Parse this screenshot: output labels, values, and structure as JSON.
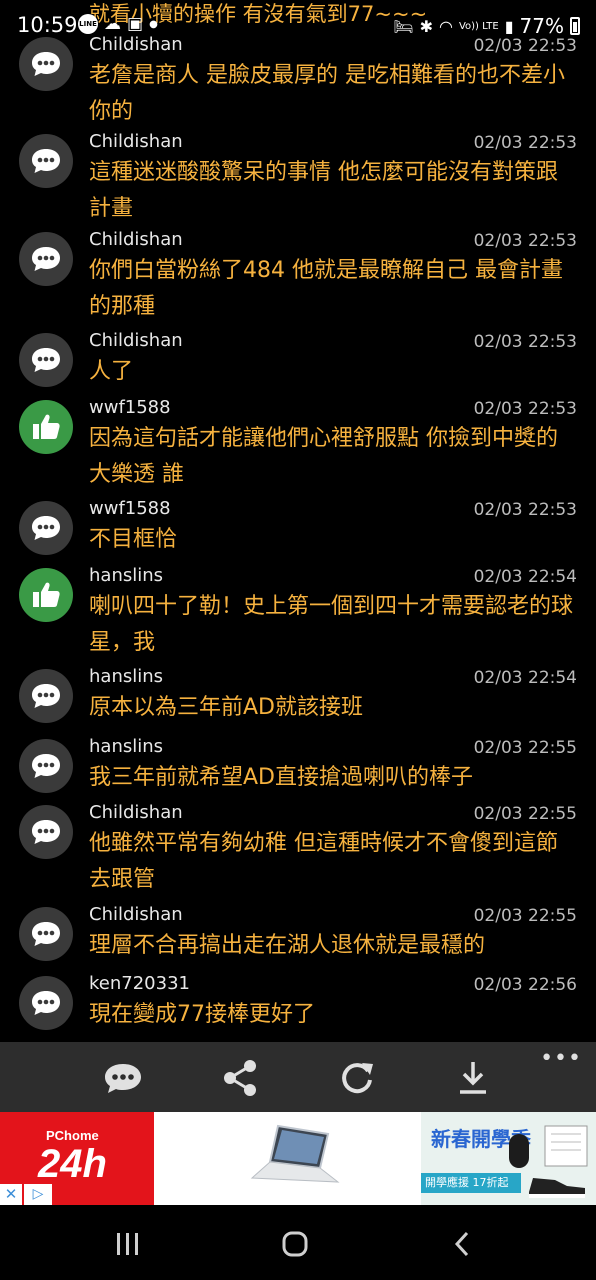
{
  "status_bar": {
    "time": "10:59",
    "line_badge": "LINE",
    "signal_label": "Vo)) LTE",
    "battery": "77%"
  },
  "partial_top_text": "就看小犢的操作 有沒有氣到77~~~",
  "comments": [
    {
      "type": "chat",
      "author": "Childishan",
      "time": "02/03 22:53",
      "text": "老詹是商人 是臉皮最厚的 是吃相難看的也不差小你的"
    },
    {
      "type": "chat",
      "author": "Childishan",
      "time": "02/03 22:53",
      "text": "這種迷迷酸酸驚呆的事情 他怎麼可能沒有對策跟計畫"
    },
    {
      "type": "chat",
      "author": "Childishan",
      "time": "02/03 22:53",
      "text": "你們白當粉絲了484 他就是最瞭解自己 最會計畫的那種"
    },
    {
      "type": "chat",
      "author": "Childishan",
      "time": "02/03 22:53",
      "text": "人了"
    },
    {
      "type": "like",
      "author": "wwf1588",
      "time": "02/03 22:53",
      "text": "因為這句話才能讓他們心裡舒服點 你撿到中獎的大樂透 誰"
    },
    {
      "type": "chat",
      "author": "wwf1588",
      "time": "02/03 22:53",
      "text": "不目框恰"
    },
    {
      "type": "like",
      "author": "hanslins",
      "time": "02/03 22:54",
      "text": "喇叭四十了勒！史上第一個到四十才需要認老的球星，我"
    },
    {
      "type": "chat",
      "author": "hanslins",
      "time": "02/03 22:54",
      "text": "原本以為三年前AD就該接班"
    },
    {
      "type": "chat",
      "author": "hanslins",
      "time": "02/03 22:55",
      "text": "我三年前就希望AD直接搶過喇叭的棒子"
    },
    {
      "type": "chat",
      "author": "Childishan",
      "time": "02/03 22:55",
      "text": "他雖然平常有夠幼稚 但這種時候才不會傻到這節去跟管"
    },
    {
      "type": "chat",
      "author": "Childishan",
      "time": "02/03 22:55",
      "text": "理層不合再搞出走在湖人退休就是最穩的"
    },
    {
      "type": "chat",
      "author": "ken720331",
      "time": "02/03 22:56",
      "text": "現在變成77接棒更好了"
    }
  ],
  "toolbar": {
    "buttons": [
      "comment-icon",
      "share-icon",
      "refresh-icon",
      "download-icon"
    ],
    "more": "•••"
  },
  "ad": {
    "brand_small": "PChome",
    "brand_big": "24h",
    "close": "✕",
    "promo_title": "新春開學季",
    "promo_sub": "開學應援 17折起"
  },
  "colors": {
    "comment_text": "#f6b23f",
    "like_avatar": "#3a9a46",
    "chat_avatar": "#3a3a3a",
    "toolbar_bg": "#2d2d2d",
    "ad_red": "#e3141b"
  }
}
